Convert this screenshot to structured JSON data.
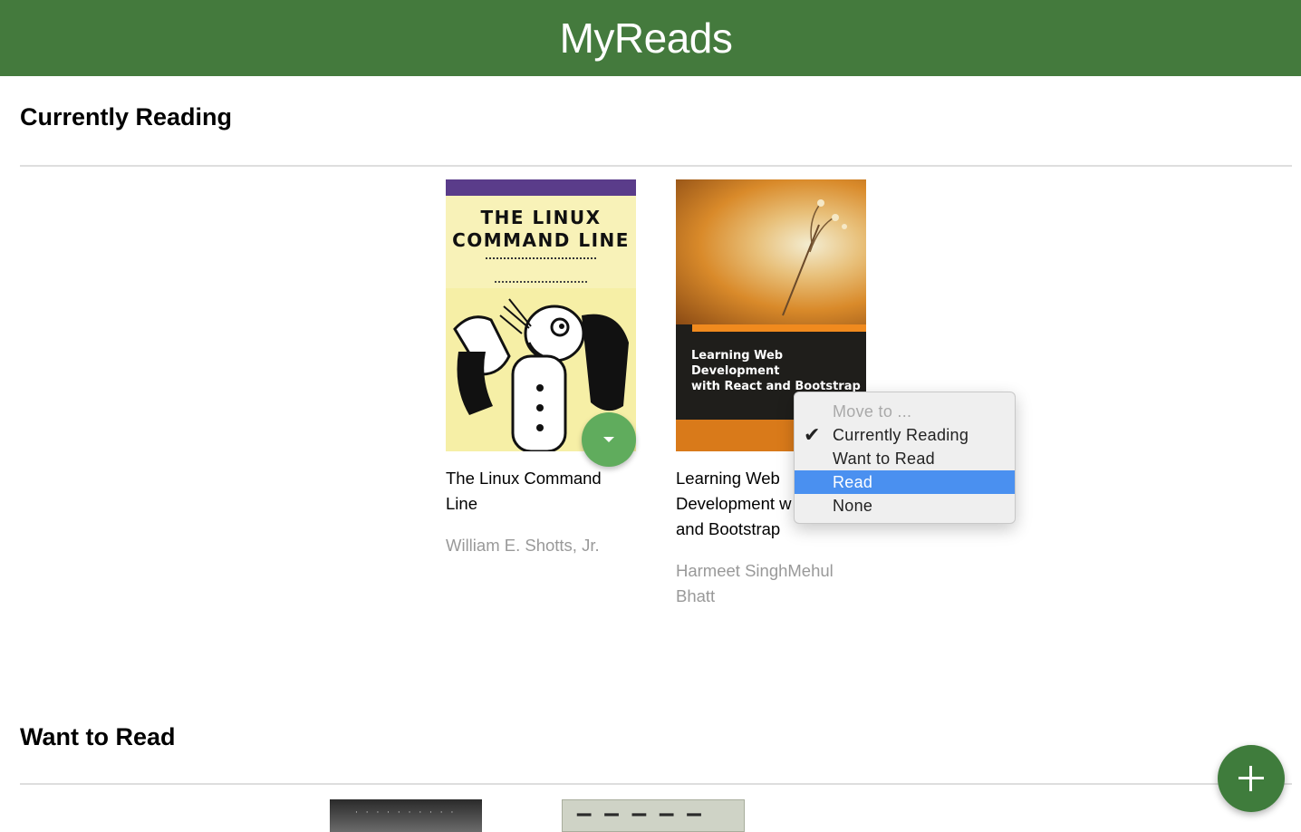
{
  "header": {
    "title": "MyReads"
  },
  "shelves": [
    {
      "title": "Currently Reading",
      "books": [
        {
          "title_line1": "The Linux Command",
          "title_line2": "Line",
          "authors": "William E. Shotts, Jr.",
          "cover_title_line1": "THE LINUX",
          "cover_title_line2": "COMMAND LINE"
        },
        {
          "title_line1": "Learning Web",
          "title_line2": "Development w",
          "title_line3": "and Bootstrap",
          "authors_line1": "Harmeet SinghMehul",
          "authors_line2": "Bhatt",
          "cover_title_line1": "Learning Web Development",
          "cover_title_line2": "with React and Bootstrap"
        }
      ]
    },
    {
      "title": "Want to Read"
    }
  ],
  "move_menu": {
    "items": [
      {
        "label": "Move to ...",
        "state": "disabled"
      },
      {
        "label": "Currently Reading",
        "state": "checked"
      },
      {
        "label": "Want to Read",
        "state": "normal"
      },
      {
        "label": "Read",
        "state": "highlighted"
      },
      {
        "label": "None",
        "state": "normal"
      }
    ]
  },
  "icons": {
    "shelf_changer": "caret-down-icon",
    "add": "plus-icon",
    "check": "check-icon"
  },
  "colors": {
    "header": "#447a3d",
    "shelf_changer": "#60ac5d",
    "menu_highlight": "#4a90f0",
    "add_button": "#3f7c3c"
  }
}
